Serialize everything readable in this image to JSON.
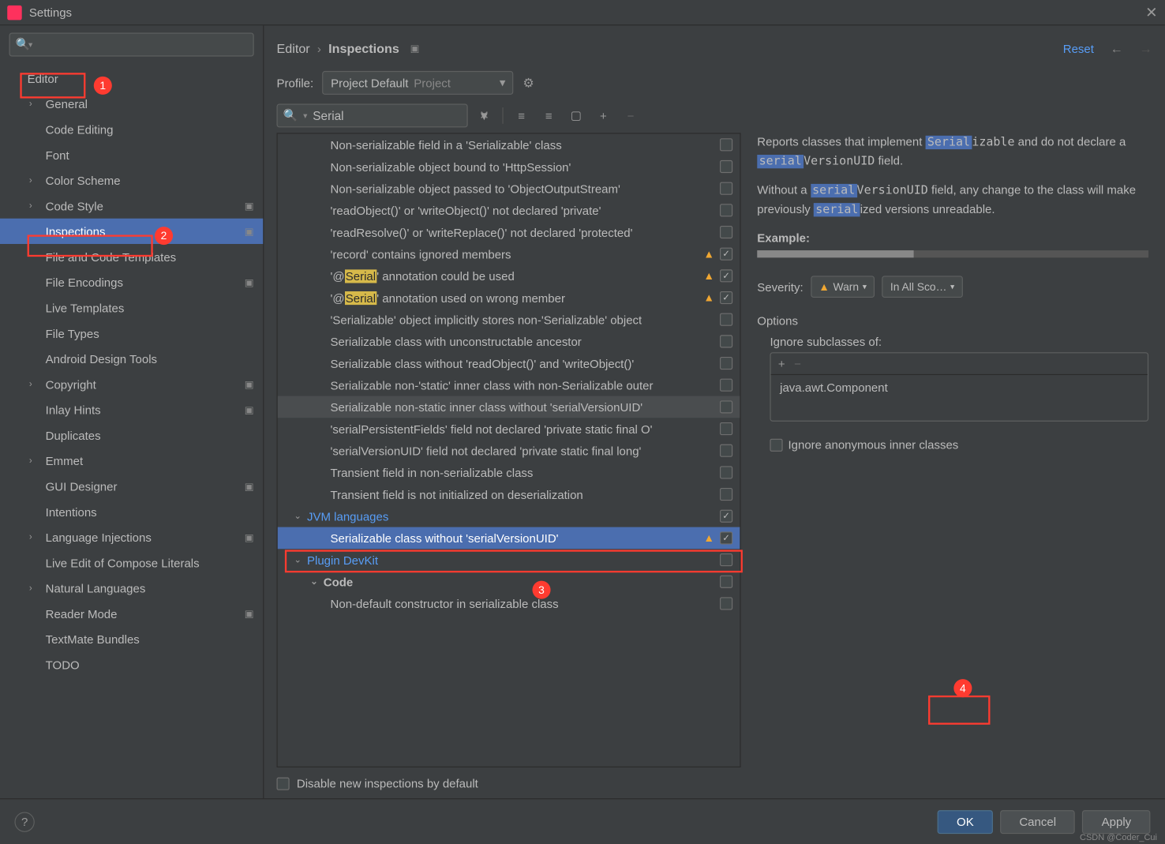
{
  "window": {
    "title": "Settings"
  },
  "breadcrumb": {
    "a": "Editor",
    "b": "Inspections",
    "reset": "Reset"
  },
  "profile": {
    "label": "Profile:",
    "name": "Project Default",
    "scope": "Project"
  },
  "search": {
    "placeholder": "",
    "value": "Serial"
  },
  "sidebar": {
    "items": [
      {
        "label": "Editor",
        "lvl": 1,
        "arrow": false,
        "boxed": true
      },
      {
        "label": "General",
        "lvl": 2,
        "arrow": true
      },
      {
        "label": "Code Editing",
        "lvl": 2
      },
      {
        "label": "Font",
        "lvl": 2
      },
      {
        "label": "Color Scheme",
        "lvl": 2,
        "arrow": true
      },
      {
        "label": "Code Style",
        "lvl": 2,
        "arrow": true,
        "cfg": true
      },
      {
        "label": "Inspections",
        "lvl": 2,
        "selected": true,
        "cfg": true,
        "boxed2": true
      },
      {
        "label": "File and Code Templates",
        "lvl": 2
      },
      {
        "label": "File Encodings",
        "lvl": 2,
        "cfg": true
      },
      {
        "label": "Live Templates",
        "lvl": 2
      },
      {
        "label": "File Types",
        "lvl": 2
      },
      {
        "label": "Android Design Tools",
        "lvl": 2
      },
      {
        "label": "Copyright",
        "lvl": 2,
        "arrow": true,
        "cfg": true
      },
      {
        "label": "Inlay Hints",
        "lvl": 2,
        "cfg": true
      },
      {
        "label": "Duplicates",
        "lvl": 2
      },
      {
        "label": "Emmet",
        "lvl": 2,
        "arrow": true
      },
      {
        "label": "GUI Designer",
        "lvl": 2,
        "cfg": true
      },
      {
        "label": "Intentions",
        "lvl": 2
      },
      {
        "label": "Language Injections",
        "lvl": 2,
        "arrow": true,
        "cfg": true
      },
      {
        "label": "Live Edit of Compose Literals",
        "lvl": 2
      },
      {
        "label": "Natural Languages",
        "lvl": 2,
        "arrow": true
      },
      {
        "label": "Reader Mode",
        "lvl": 2,
        "cfg": true
      },
      {
        "label": "TextMate Bundles",
        "lvl": 2
      },
      {
        "label": "TODO",
        "lvl": 2
      }
    ]
  },
  "tree": [
    {
      "label": "Non-serializable field in a 'Serializable' class",
      "cb": false
    },
    {
      "label": "Non-serializable object bound to 'HttpSession'",
      "cb": false
    },
    {
      "label": "Non-serializable object passed to 'ObjectOutputStream'",
      "cb": false
    },
    {
      "label": "'readObject()' or 'writeObject()' not declared 'private'",
      "cb": false
    },
    {
      "label": "'readResolve()' or 'writeReplace()' not declared 'protected'",
      "cb": false
    },
    {
      "label": "'record' contains ignored members",
      "cb": true,
      "warn": true
    },
    {
      "label_html": "'@<hl>Serial</hl>' annotation could be used",
      "cb": true,
      "warn": true
    },
    {
      "label_html": "'@<hl>Serial</hl>' annotation used on wrong member",
      "cb": true,
      "warn": true
    },
    {
      "label": "'Serializable' object implicitly stores non-'Serializable' object",
      "cb": false
    },
    {
      "label": "Serializable class with unconstructable ancestor",
      "cb": false
    },
    {
      "label": "Serializable class without 'readObject()' and 'writeObject()'",
      "cb": false
    },
    {
      "label": "Serializable non-'static' inner class with non-Serializable outer",
      "cb": false
    },
    {
      "label": "Serializable non-static inner class without 'serialVersionUID'",
      "cb": false,
      "hover": true
    },
    {
      "label": "'serialPersistentFields' field not declared 'private static final O'",
      "cb": false
    },
    {
      "label": "'serialVersionUID' field not declared 'private static final long'",
      "cb": false
    },
    {
      "label": "Transient field in non-serializable class",
      "cb": false
    },
    {
      "label": "Transient field is not initialized on deserialization",
      "cb": false
    },
    {
      "group": "JVM languages",
      "cb": true
    },
    {
      "label": "Serializable class without 'serialVersionUID'",
      "cb": true,
      "warn": true,
      "selected": true,
      "boxed3": true
    },
    {
      "group": "Plugin DevKit",
      "cb": false
    },
    {
      "group2": "Code",
      "cb": false
    },
    {
      "label": "Non-default constructor in serializable class",
      "cb": false
    }
  ],
  "details": {
    "p1a": "Reports classes that implement ",
    "p1b": "Serial",
    "p1c": "izable",
    "p1d": " and do not declare a ",
    "p1e": "serial",
    "p1f": "VersionUID",
    "p1g": " field.",
    "p2a": "Without a ",
    "p2b": "serial",
    "p2c": "VersionUID",
    "p2d": " field, any change to the class will make previously ",
    "p2e": "serial",
    "p2f": "ized versions unreadable.",
    "example": "Example:",
    "severity": "Severity:",
    "sev_val": "Warn",
    "scope_val": "In All Sco…",
    "options": "Options",
    "ignore_sub": "Ignore subclasses of:",
    "sub_value": "java.awt.Component",
    "ignore_anon": "Ignore anonymous inner classes"
  },
  "footer": {
    "disable": "Disable new inspections by default"
  },
  "buttons": {
    "ok": "OK",
    "cancel": "Cancel",
    "apply": "Apply"
  },
  "watermark": "CSDN @Coder_Cui"
}
